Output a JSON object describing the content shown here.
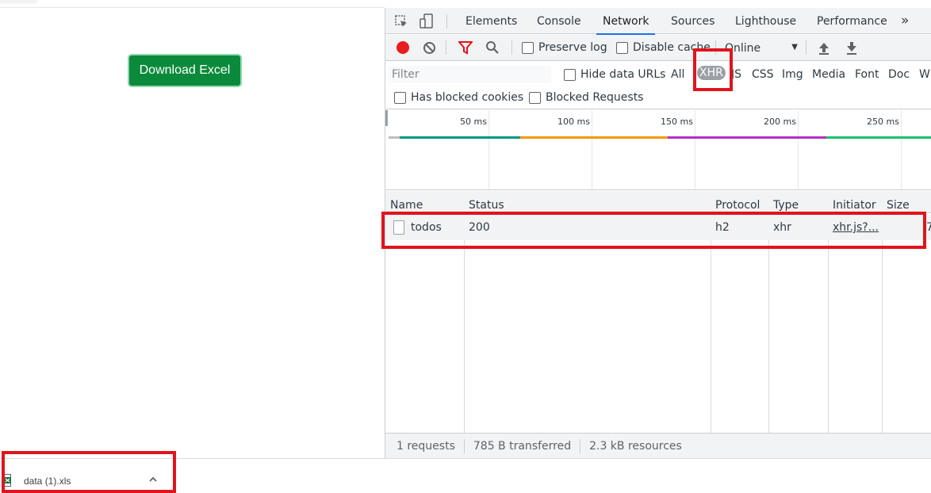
{
  "page": {
    "download_button_label": "Download Excel"
  },
  "devtools": {
    "tabs": [
      {
        "label": "Elements",
        "active": false
      },
      {
        "label": "Console",
        "active": false
      },
      {
        "label": "Network",
        "active": true
      },
      {
        "label": "Sources",
        "active": false
      },
      {
        "label": "Lighthouse",
        "active": false
      },
      {
        "label": "Performance",
        "active": false
      }
    ],
    "more_tabs_label": "»",
    "toolbar": {
      "preserve_log_label": "Preserve log",
      "disable_cache_label": "Disable cache",
      "throttling_value": "Online"
    },
    "filter": {
      "placeholder": "Filter",
      "hide_data_urls_label": "Hide data URLs",
      "types": [
        "All",
        "XHR",
        "JS",
        "CSS",
        "Img",
        "Media",
        "Font",
        "Doc",
        "W"
      ],
      "active_type": "XHR",
      "has_blocked_cookies_label": "Has blocked cookies",
      "blocked_requests_label": "Blocked Requests"
    },
    "overview": {
      "ticks": [
        "50 ms",
        "100 ms",
        "150 ms",
        "200 ms",
        "250 ms"
      ]
    },
    "table": {
      "columns": [
        "Name",
        "Status",
        "Protocol",
        "Type",
        "Initiator",
        "Size"
      ],
      "rows": [
        {
          "name": "todos",
          "status": "200",
          "protocol": "h2",
          "type": "xhr",
          "initiator": "xhr.js?...",
          "size": "7"
        }
      ]
    },
    "status": {
      "requests": "1 requests",
      "transferred": "785 B transferred",
      "resources": "2.3 kB resources"
    }
  },
  "download_bar": {
    "file_name": "data (1).xls"
  },
  "colors": {
    "accent": "#1a73e8",
    "record": "#ea1e1e",
    "download_button": "#0a8a3a",
    "highlight": "#e0141e"
  }
}
